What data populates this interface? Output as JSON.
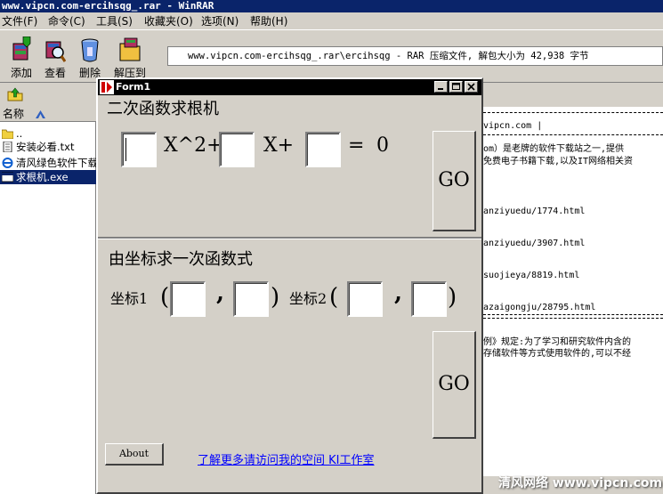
{
  "winrar": {
    "title": "www.vipcn.com-ercihsqg_.rar - WinRAR",
    "menu": [
      "文件(F)",
      "命令(C)",
      "工具(S)",
      "收藏夹(O)",
      "选项(N)",
      "帮助(H)"
    ],
    "toolbar": [
      "添加",
      "查看",
      "删除",
      "解压到"
    ],
    "path": "www.vipcn.com-ercihsqg_.rar\\ercihsqg - RAR 压缩文件, 解包大小为 42,938 字节",
    "list_header": "名称",
    "files": [
      {
        "name": "..",
        "icon": "folder-icon"
      },
      {
        "name": "安装必看.txt",
        "icon": "text-file-icon"
      },
      {
        "name": "清风绿色软件下载",
        "icon": "ie-link-icon"
      },
      {
        "name": "求根机.exe",
        "icon": "exe-icon"
      }
    ],
    "info_lines": [
      "vipcn.com |",
      "om）是老牌的软件下载站之一,提供",
      "免费电子书籍下载,以及IT网络相关资",
      "anziyuedu/1774.html",
      "anziyuedu/3907.html",
      "suojieya/8819.html",
      "azaigongju/28795.html",
      "例》规定:为了学习和研究软件内含的",
      "存储软件等方式使用软件的,可以不经"
    ],
    "watermark": "清风网络 www.vipcn.com"
  },
  "form1": {
    "title": "Form1",
    "section1_heading": "二次函数求根机",
    "eq_x2": "X^2+",
    "eq_x": "X+",
    "eq_equals": "=",
    "eq_zero": "0",
    "go_label": "GO",
    "section2_heading": "由坐标求一次函数式",
    "coord1_label": "坐标1",
    "coord2_label": "坐标2",
    "open_paren": "(",
    "close_paren": ")",
    "comma": ",",
    "go2_label": "GO",
    "about_label": "About",
    "link_text": "了解更多请访问我的空间 KI工作室"
  }
}
